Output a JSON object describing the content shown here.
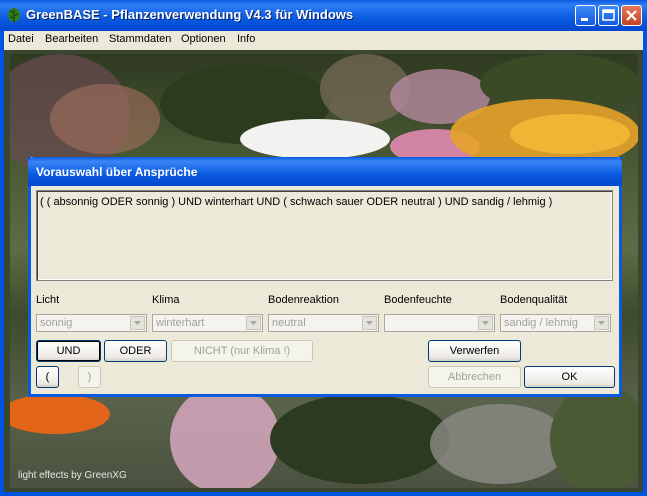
{
  "window": {
    "title": "GreenBASE - Pflanzenverwendung  V4.3  für Windows",
    "buttons": [
      "minimize-icon",
      "maximize-icon",
      "close-icon"
    ]
  },
  "menu": {
    "items": [
      "Datei",
      "Bearbeiten",
      "Stammdaten",
      "Optionen",
      "Info"
    ]
  },
  "background": {
    "credit": "light effects by GreenXG"
  },
  "dialog": {
    "title": "Vorauswahl über Ansprüche",
    "query": "( ( absonnig ODER sonnig ) UND winterhart UND ( schwach sauer ODER neutral ) UND sandig / lehmig )",
    "fields": [
      {
        "label": "Licht",
        "value": "sonnig"
      },
      {
        "label": "Klima",
        "value": "winterhart"
      },
      {
        "label": "Bodenreaktion",
        "value": "neutral"
      },
      {
        "label": "Bodenfeuchte",
        "value": ""
      },
      {
        "label": "Bodenqualität",
        "value": "sandig / lehmig"
      }
    ],
    "buttons": {
      "und": "UND",
      "oder": "ODER",
      "nicht": "NICHT (nur Klima !)",
      "verwerfen": "Verwerfen",
      "open_paren": "(",
      "close_paren": ")",
      "abbrechen": "Abbrechen",
      "ok": "OK"
    }
  },
  "colors": {
    "titlebar": "#0a5ae0",
    "dialog_bg": "#ece9d8",
    "close_button": "#c2401f"
  }
}
